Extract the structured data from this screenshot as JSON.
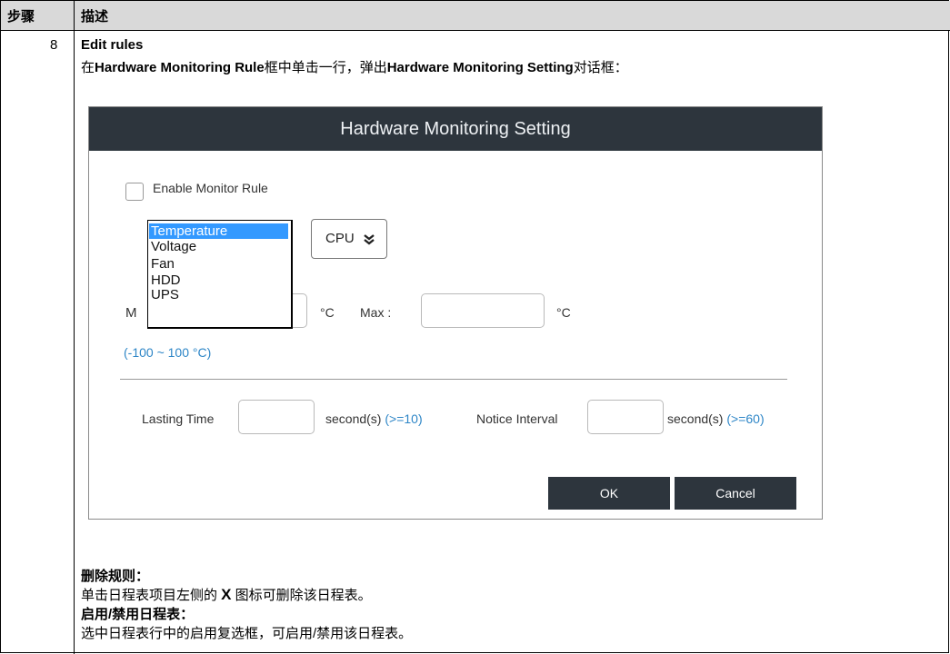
{
  "table": {
    "header_step": "步骤",
    "header_desc": "描述",
    "step_number": "8"
  },
  "content": {
    "heading": "Edit rules",
    "intro_prefix": "在",
    "intro_rule": "Hardware Monitoring Rule",
    "intro_mid": "框中单击一行，弹出",
    "intro_setting": "Hardware Monitoring Setting",
    "intro_suffix": "对话框：",
    "delete_title": "删除规则：",
    "delete_text_a": "单击日程表项目左侧的 ",
    "delete_x": "X",
    "delete_text_b": " 图标可删除该日程表。",
    "toggle_title": "启用/禁用日程表：",
    "toggle_text": "选中日程表行中的启用复选框，可启用/禁用该日程表。"
  },
  "dialog": {
    "title": "Hardware Monitoring Setting",
    "enable_label": "Enable Monitor Rule",
    "enable_checked": false,
    "type_options": [
      "Temperature",
      "Voltage",
      "Fan",
      "HDD",
      "UPS"
    ],
    "type_selected": "Temperature",
    "component_value": "CPU",
    "component_icon": "double-chevron-down-icon",
    "min_label_fragment": "M",
    "min_unit": "°C",
    "max_label": "Max :",
    "max_unit": "°C",
    "range_hint": "(-100 ~ 100 °C)",
    "lasting_label": "Lasting Time",
    "lasting_unit": "second(s)",
    "lasting_hint": "(>=10)",
    "notice_label": "Notice Interval",
    "notice_unit": "second(s)",
    "notice_hint": "(>=60)",
    "ok_label": "OK",
    "cancel_label": "Cancel"
  },
  "colors": {
    "title_bar": "#2d353d",
    "selection": "#3399ff",
    "hint": "#2e86c7",
    "table_header": "#d9d9d9"
  }
}
